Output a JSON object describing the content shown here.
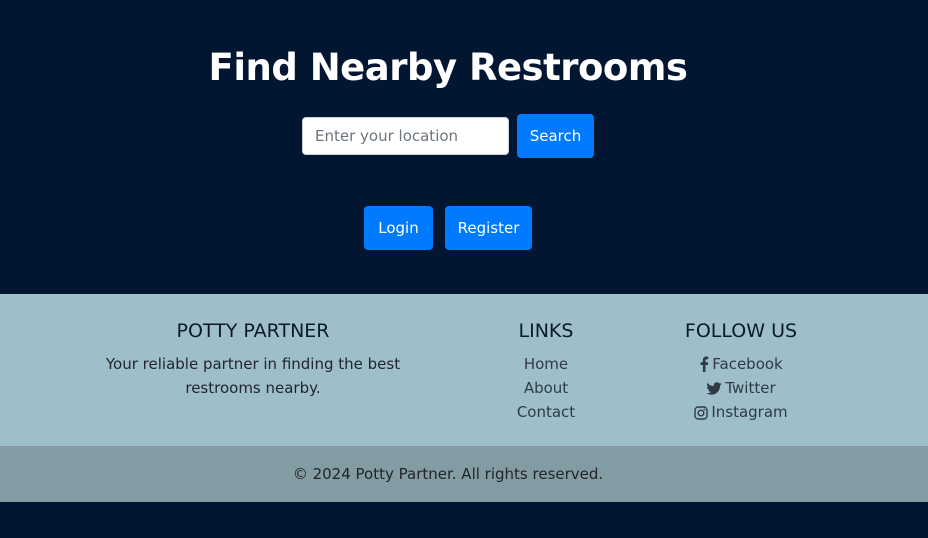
{
  "hero": {
    "title": "Find Nearby Restrooms",
    "search_placeholder": "Enter your location",
    "search_value": "",
    "search_label": "Search",
    "login_label": "Login",
    "register_label": "Register"
  },
  "footer": {
    "brand": {
      "heading": "POTTY PARTNER",
      "description": "Your reliable partner in finding the best restrooms nearby."
    },
    "links": {
      "heading": "LINKS",
      "items": [
        "Home",
        "About",
        "Contact"
      ]
    },
    "follow": {
      "heading": "FOLLOW US",
      "items": [
        {
          "label": "Facebook",
          "icon": "facebook-icon"
        },
        {
          "label": "Twitter",
          "icon": "twitter-icon"
        },
        {
          "label": "Instagram",
          "icon": "instagram-icon"
        }
      ]
    },
    "copyright": "© 2024 Potty Partner. All rights reserved."
  },
  "colors": {
    "page_bg": "#021631",
    "primary_button": "#007bff",
    "footer_bg": "#9ebfca",
    "copyright_bg": "#839ba2"
  }
}
